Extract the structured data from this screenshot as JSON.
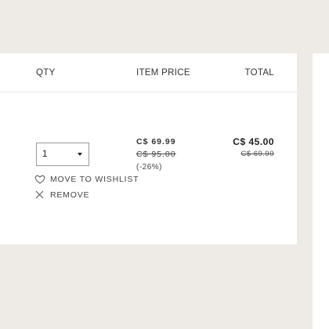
{
  "table": {
    "headers": {
      "qty": "QTY",
      "item_price": "ITEM PRICE",
      "total": "TOTAL"
    }
  },
  "item": {
    "quantity": {
      "selected": "1",
      "icon": "chevron-down-icon"
    },
    "actions": {
      "wishlist_label": "MOVE TO WISHLIST",
      "wishlist_icon": "heart-icon",
      "remove_label": "REMOVE",
      "remove_icon": "close-icon"
    },
    "item_price": {
      "current": "C$ 69.99",
      "original": "C$ 95.00",
      "discount": "(-26%)"
    },
    "total": {
      "current": "C$ 45.00",
      "original": "C$ 69.99"
    }
  },
  "colors": {
    "page_background": "#eeebe7",
    "card_background": "#ffffff",
    "text": "#222222"
  }
}
